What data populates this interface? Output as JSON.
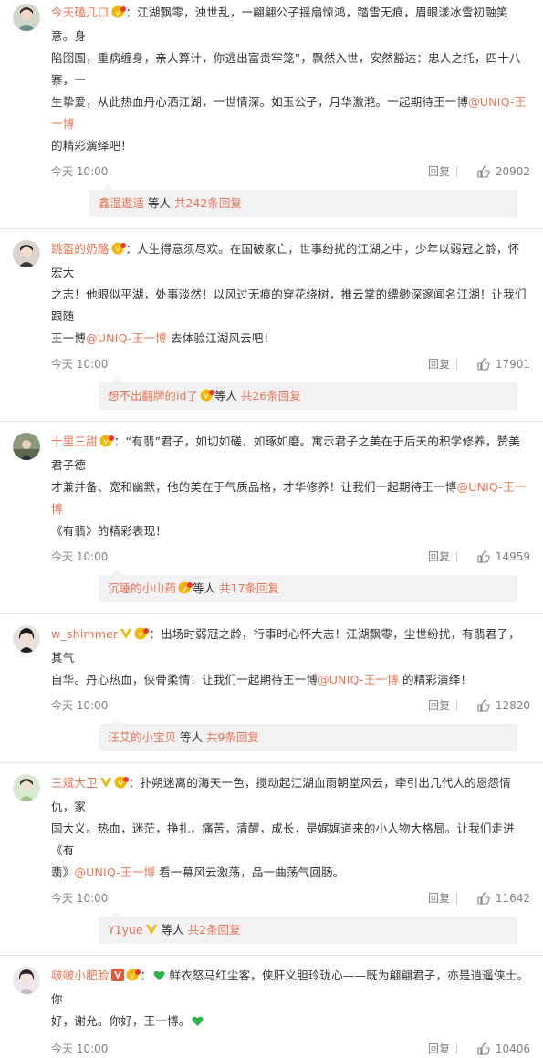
{
  "comments": [
    {
      "user": "今天磕几口",
      "colon": "：",
      "text_lines": [
        "江湖飘零，浊世乱，一翩翩公子摇扇惊鸿，踏雪无痕，眉眼漾冰雪初融笑意。身",
        "陷囹圄，重病缠身，亲人算计，你逃出富贵牢笼”，飘然入世，安然豁达：忠人之托，四十八寨，一",
        "生挚爱，从此热血丹心洒江湖，一世情深。如玉公子，月华激滟。一起期待王一博"
      ],
      "mention": "@UNIQ-王一博",
      "tail": "的精彩演绎吧！",
      "time": "今天 10:00",
      "reply": "回复",
      "likes": "20902",
      "sub_user": "鑫湿遨适",
      "sub_mid": " 等人 ",
      "sub_count": "共242条回复"
    },
    {
      "user": "跳盔的奶酪",
      "colon": "：",
      "text_lines": [
        "人生得意须尽欢。在国破家亡，世事纷扰的江湖之中，少年以弱冠之龄，怀宏大",
        "之志！他眼似平湖，处事淡然！以风过无痕的穿花绕树，推云掌的缥缈深邃闻名江湖！让我们跟随"
      ],
      "mention": "@UNIQ-王一博",
      "tail": " 去体验江湖风云吧！",
      "lead": "王一博",
      "time": "今天 10:00",
      "reply": "回复",
      "likes": "17901",
      "sub_user": "想不出翻牌的id了",
      "sub_mid": "等人 ",
      "sub_count": "共26条回复"
    },
    {
      "user": "十里三甜",
      "colon": "：",
      "text_lines": [
        "“有翡”君子，如切如磋，如琢如磨。寓示君子之美在于后天的积学修养，赞美君子德",
        "才兼并备、宽和幽默，他的美在于气质品格，才华修养！让我们一起期待王一博"
      ],
      "mention": "@UNIQ-王一博",
      "tail": "",
      "line3": "《有翡》的精彩表现！",
      "time": "今天 10:00",
      "reply": "回复",
      "likes": "14959",
      "sub_user": "沉睡的小山药",
      "sub_mid": "等人 ",
      "sub_count": "共17条回复"
    },
    {
      "user": "w_shimmer",
      "colon": "：",
      "text_lines": [
        "出场时弱冠之龄，行事时心怀大志！江湖飘零，尘世纷扰，有翡君子，其气",
        "自华。丹心热血，侠骨柔情！让我们一起期待王一博"
      ],
      "mention": "@UNIQ-王一博",
      "tail": " 的精彩演绎！",
      "time": "今天 10:00",
      "reply": "回复",
      "likes": "12820",
      "sub_user": "汪艾的小宝贝",
      "sub_mid": " 等人 ",
      "sub_count": "共9条回复"
    },
    {
      "user": "三斌大卫",
      "colon": "：",
      "text_lines": [
        "扑朔迷离的海天一色，搅动起江湖血雨朝堂风云，牵引出几代人的恩怨情仇，家",
        "国大义。热血，迷茫，挣扎，痛苦，清醒，成长，是娓娓道来的小人物大格局。让我们走进《有",
        "翡》"
      ],
      "mention": "@UNIQ-王一博",
      "tail": " 看一幕风云激荡，品一曲荡气回肠。",
      "time": "今天 10:00",
      "reply": "回复",
      "likes": "11642",
      "sub_user": "Y1yue",
      "sub_mid": " 等人 ",
      "sub_count": "共2条回复"
    },
    {
      "user": "啵啵小肥脸",
      "colon": "：",
      "text_lines": [
        " 鲜衣怒马红尘客，侠肝义胆玲珑心——既为翩翩君子，亦是逍遥侠士。你",
        "好，谢允。你好，王一博。"
      ],
      "time": "今天 10:00",
      "reply": "回复",
      "likes": "10406"
    }
  ],
  "colors": {
    "accent": "#eb7350",
    "meta": "#808080",
    "subbg": "#f2f2f5",
    "badge": "#f7b500"
  }
}
